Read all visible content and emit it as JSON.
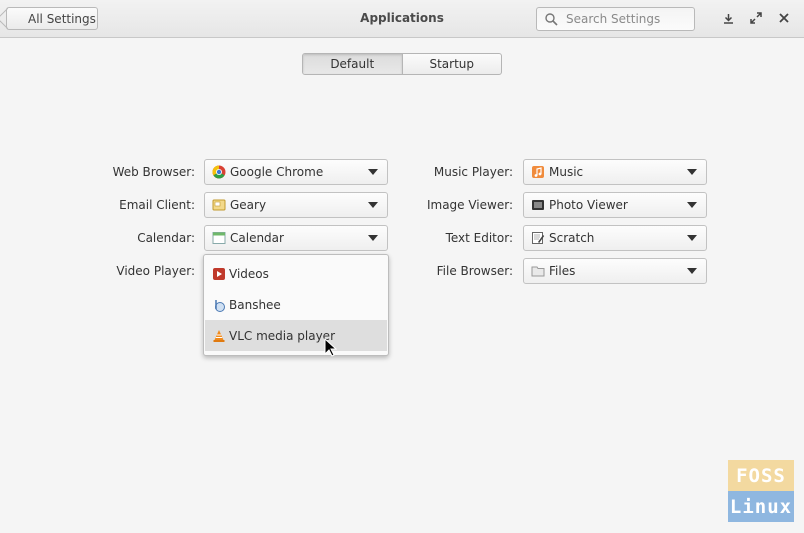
{
  "header": {
    "back_label": "All Settings",
    "title": "Applications",
    "search_placeholder": "Search Settings"
  },
  "window_buttons": [
    "download-icon",
    "maximize-icon",
    "close-icon"
  ],
  "mode_switch": {
    "options": [
      "Default",
      "Startup"
    ],
    "selected": "Default"
  },
  "defaults": {
    "web_browser": {
      "label": "Web Browser:",
      "value": "Google Chrome",
      "icon": "chrome-icon"
    },
    "email_client": {
      "label": "Email Client:",
      "value": "Geary",
      "icon": "geary-icon"
    },
    "calendar": {
      "label": "Calendar:",
      "value": "Calendar",
      "icon": "calendar-icon"
    },
    "video_player": {
      "label": "Video Player:"
    },
    "music_player": {
      "label": "Music Player:",
      "value": "Music",
      "icon": "music-icon"
    },
    "image_viewer": {
      "label": "Image Viewer:",
      "value": "Photo Viewer",
      "icon": "photo-viewer-icon"
    },
    "text_editor": {
      "label": "Text Editor:",
      "value": "Scratch",
      "icon": "scratch-icon"
    },
    "file_browser": {
      "label": "File Browser:",
      "value": "Files",
      "icon": "files-icon"
    }
  },
  "video_menu": {
    "items": [
      {
        "label": "Videos",
        "icon": "videos-icon"
      },
      {
        "label": "Banshee",
        "icon": "banshee-icon"
      },
      {
        "label": "VLC media player",
        "icon": "vlc-icon",
        "highlighted": true
      }
    ]
  },
  "watermark": {
    "line1": "FOSS",
    "line2": "Linux"
  },
  "colors": {
    "background": "#f5f5f5",
    "menu_highlight": "#dedede",
    "watermark_top": "#f3d9a0",
    "watermark_bottom": "#8fb7e0"
  }
}
